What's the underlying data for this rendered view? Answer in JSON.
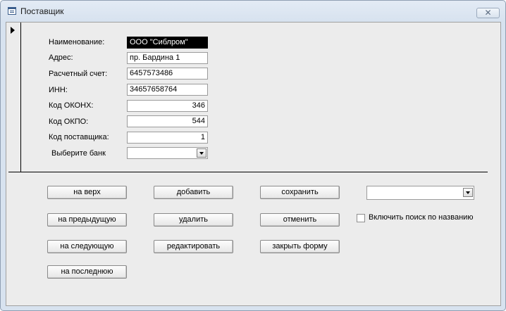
{
  "window": {
    "title": "Поставщик",
    "close_glyph": "✕"
  },
  "form": {
    "fields": [
      {
        "label": "Наименование:",
        "value": "ООО \"Сиблром\""
      },
      {
        "label": "Адрес:",
        "value": "пр. Бардина 1"
      },
      {
        "label": "Расчетный счет:",
        "value": "6457573486"
      },
      {
        "label": "ИНН:",
        "value": "34657658764"
      },
      {
        "label": "Код ОКОНХ:",
        "value": "346"
      },
      {
        "label": "Код ОКПО:",
        "value": "544"
      },
      {
        "label": "Код поставщика:",
        "value": "1"
      }
    ],
    "bank": {
      "label": "Выберите банк",
      "value": ""
    }
  },
  "buttons": {
    "first": "на верх",
    "prev": "на предыдущую",
    "next": "на следующую",
    "last": "на последнюю",
    "add": "добавить",
    "delete": "удалить",
    "edit": "редактировать",
    "save": "сохранить",
    "cancel": "отменить",
    "close_form": "закрыть форму"
  },
  "search": {
    "combo_value": "",
    "checkbox_label": "Включить поиск по названию",
    "checked": false
  }
}
